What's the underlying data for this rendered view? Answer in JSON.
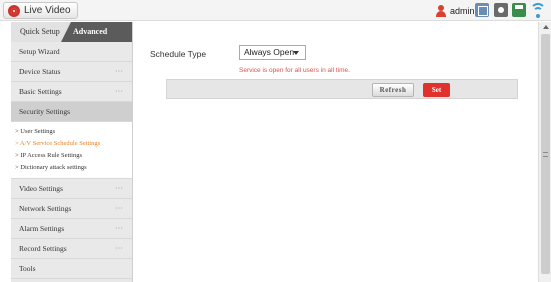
{
  "topbar": {
    "live_video_label": "Live Video",
    "user_name": "admin",
    "icons": [
      "network-icon",
      "settings-icon",
      "storage-icon",
      "wifi-icon"
    ]
  },
  "sidebar": {
    "tabs": [
      {
        "label": "Quick Setup",
        "active": false
      },
      {
        "label": "Advanced Settings",
        "active": true
      }
    ],
    "items": [
      {
        "label": "Setup Wizard",
        "has_more": false
      },
      {
        "label": "Device Status",
        "has_more": true
      },
      {
        "label": "Basic Settings",
        "has_more": true
      },
      {
        "label": "Security Settings",
        "has_more": false,
        "expanded": true
      }
    ],
    "more_indicator": "···",
    "submenu": [
      {
        "label": "> User Settings",
        "selected": false
      },
      {
        "label": "> A/V Service Schedule Settings",
        "selected": true
      },
      {
        "label": "> IP Access Rule Settings",
        "selected": false
      },
      {
        "label": "> Dictionary attack settings",
        "selected": false
      }
    ],
    "items_after": [
      {
        "label": "Video Settings",
        "has_more": true
      },
      {
        "label": "Network Settings",
        "has_more": true
      },
      {
        "label": "Alarm Settings",
        "has_more": true
      },
      {
        "label": "Record Settings",
        "has_more": true
      },
      {
        "label": "Tools",
        "has_more": false
      }
    ]
  },
  "main": {
    "schedule_type_label": "Schedule Type",
    "schedule_type_value": "Always Open",
    "hint": "Service is open for all users in all time.",
    "refresh_label": "Refresh",
    "set_label": "Set"
  },
  "colors": {
    "accent_red": "#e0312d",
    "selected_submenu": "#e8801f",
    "hint_red": "#d9534f",
    "wifi_blue": "#3c9ad8"
  }
}
